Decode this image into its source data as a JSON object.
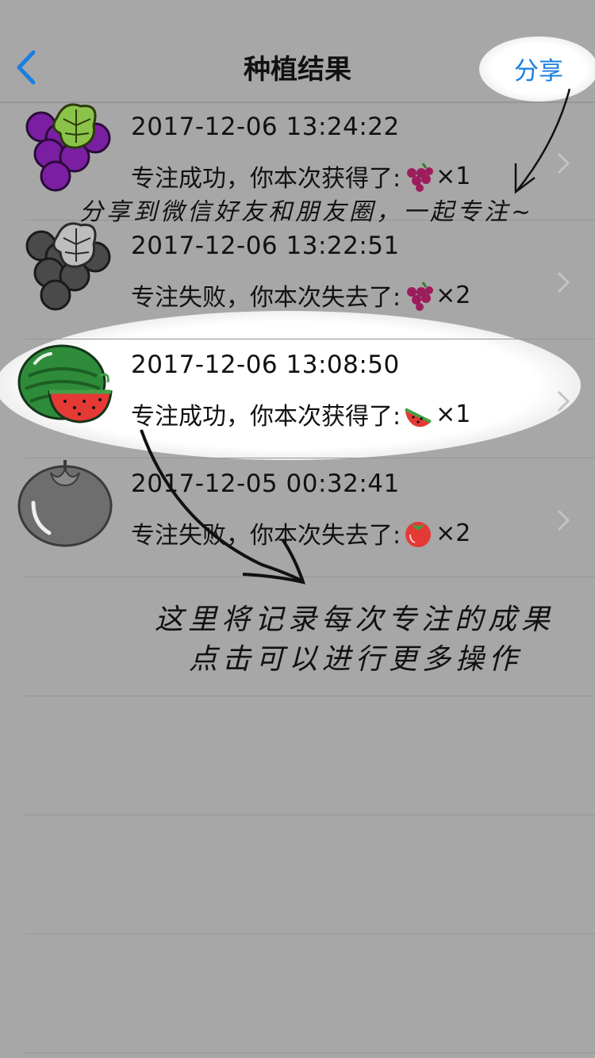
{
  "nav": {
    "title": "种植结果",
    "share_label": "分享"
  },
  "records": [
    {
      "time": "2017-12-06 13:24:22",
      "message": "专注成功，你本次获得了:",
      "fruit": "grape",
      "count": "×1",
      "state": "success"
    },
    {
      "time": "2017-12-06 13:22:51",
      "message": "专注失败，你本次失去了:",
      "fruit": "grape",
      "count": "×2",
      "state": "failed"
    },
    {
      "time": "2017-12-06 13:08:50",
      "message": "专注成功，你本次获得了:",
      "fruit": "watermelon",
      "count": "×1",
      "state": "success"
    },
    {
      "time": "2017-12-05 00:32:41",
      "message": "专注失败，你本次失去了:",
      "fruit": "tomato",
      "count": "×2",
      "state": "failed"
    }
  ],
  "annotations": {
    "share_note": "分享到微信好友和朋友圈，一起专注~",
    "list_note_line1": "这里将记录每次专注的成果",
    "list_note_line2": "点击可以进行更多操作"
  },
  "icons": {
    "back": "chevron-left-icon",
    "disclosure": "chevron-right-icon"
  },
  "colors": {
    "background": "#a7a7a7",
    "accent": "#1a7fe0",
    "separator": "#959595"
  }
}
